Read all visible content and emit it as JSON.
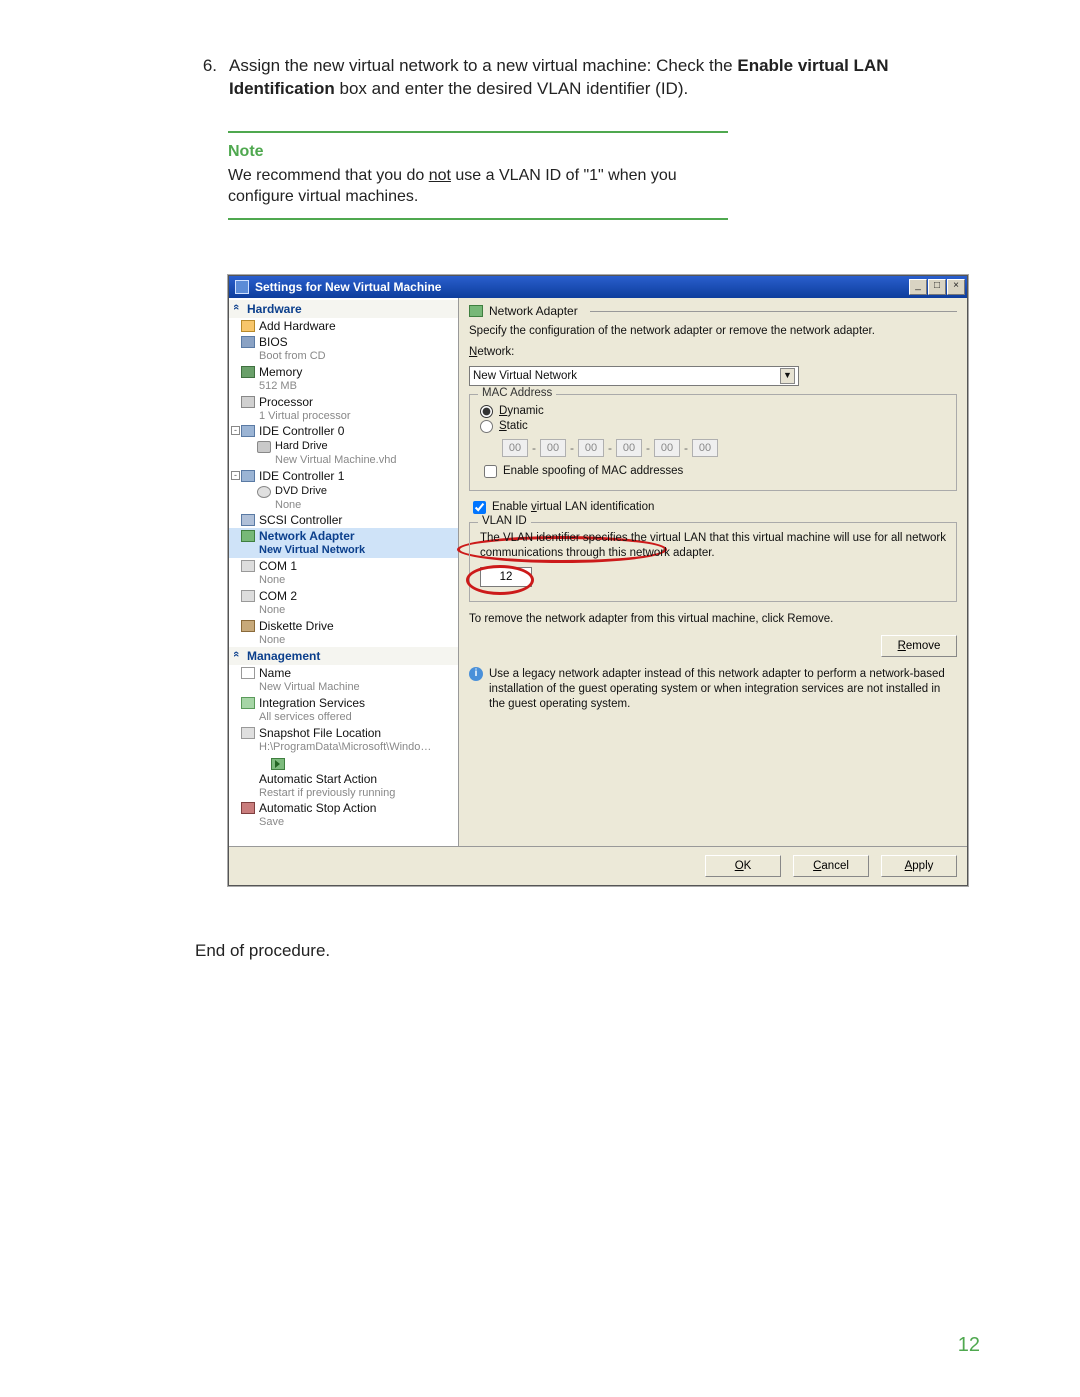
{
  "step": {
    "number": "6.",
    "text_before_bold": "Assign the new virtual network to a new virtual machine: Check the ",
    "bold1": "Enable virtual LAN Identification",
    "text_after_bold": " box and enter the desired VLAN identifier (ID)."
  },
  "note": {
    "title": "Note",
    "body_before": "We recommend that you do ",
    "body_underline": "not",
    "body_after": " use a VLAN ID of \"1\" when you configure virtual machines."
  },
  "end_of_procedure": "End of procedure.",
  "page_number": "12",
  "window": {
    "title": "Settings for New Virtual Machine",
    "minimize": "_",
    "maximize": "□",
    "close": "×",
    "sidebar": {
      "section_hardware": "Hardware",
      "add_hardware": "Add Hardware",
      "bios": "BIOS",
      "bios_sub": "Boot from CD",
      "memory": "Memory",
      "memory_sub": "512 MB",
      "processor": "Processor",
      "processor_sub": "1 Virtual processor",
      "ide0": "IDE Controller 0",
      "harddrive": "Hard Drive",
      "harddrive_sub": "New Virtual Machine.vhd",
      "ide1": "IDE Controller 1",
      "dvd": "DVD Drive",
      "dvd_sub": "None",
      "scsi": "SCSI Controller",
      "netadapter": "Network Adapter",
      "netadapter_sub": "New Virtual Network",
      "com1": "COM 1",
      "com1_sub": "None",
      "com2": "COM 2",
      "com2_sub": "None",
      "diskette": "Diskette Drive",
      "diskette_sub": "None",
      "section_management": "Management",
      "name": "Name",
      "name_sub": "New Virtual Machine",
      "integration": "Integration Services",
      "integration_sub": "All services offered",
      "snapshot": "Snapshot File Location",
      "snapshot_sub": "H:\\ProgramData\\Microsoft\\Windo…",
      "autostart": "Automatic Start Action",
      "autostart_sub": "Restart if previously running",
      "autostop": "Automatic Stop Action",
      "autostop_sub": "Save"
    },
    "pane": {
      "title": "Network Adapter",
      "desc": "Specify the configuration of the network adapter or remove the network adapter.",
      "network_label": "Network:",
      "network_value": "New Virtual Network",
      "mac_legend": "MAC Address",
      "dynamic": "Dynamic",
      "static": "Static",
      "mac_oct": "00",
      "enable_spoofing": "Enable spoofing of MAC addresses",
      "enable_vlan": "Enable virtual LAN identification",
      "vlan_legend": "VLAN ID",
      "vlan_help": "The VLAN identifier specifies the virtual LAN that this virtual machine will use for all network communications through this network adapter.",
      "vlan_value": "12",
      "remove_help": "To remove the network adapter from this virtual machine, click Remove.",
      "remove_btn": "Remove",
      "info_text": "Use a legacy network adapter instead of this network adapter to perform a network-based installation of the guest operating system or when integration services are not installed in the guest operating system."
    },
    "buttons": {
      "ok": "OK",
      "cancel": "Cancel",
      "apply": "Apply"
    }
  }
}
